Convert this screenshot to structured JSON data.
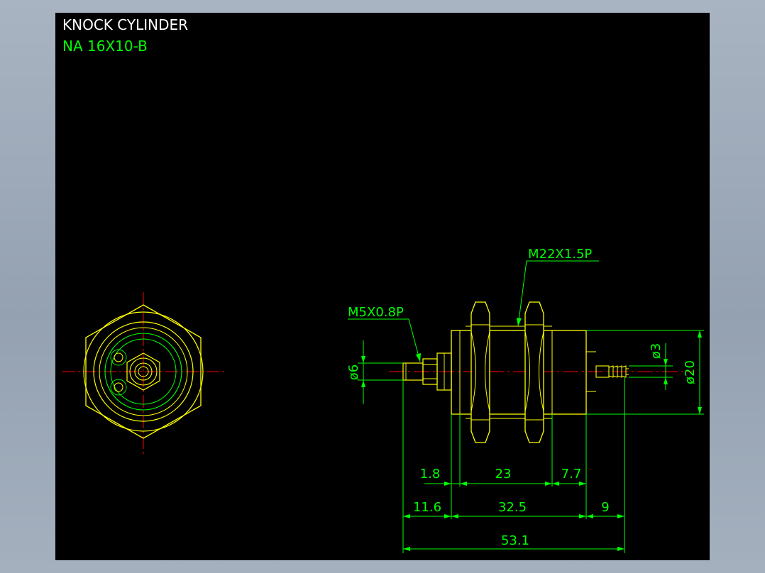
{
  "title": {
    "name": "KNOCK  CYLINDER",
    "model": "NA  16X10-B"
  },
  "callouts": {
    "body_thread": "M22X1.5P",
    "port_thread": "M5X0.8P"
  },
  "dimensions": {
    "rod_dia": "ø6",
    "nozzle_dia": "ø3",
    "body_dia": "ø20",
    "d_1_8": "1.8",
    "d_23": "23",
    "d_7_7": "7.7",
    "d_11_6": "11.6",
    "d_32_5": "32.5",
    "d_9": "9",
    "d_53_1": "53.1"
  },
  "colors": {
    "background": "#000000",
    "outline": "#ffff00",
    "dimension": "#00ff00",
    "centerline": "#ff0000",
    "title_text": "#ffffff",
    "model_text": "#00ff00",
    "callout_text": "#00ff00"
  }
}
